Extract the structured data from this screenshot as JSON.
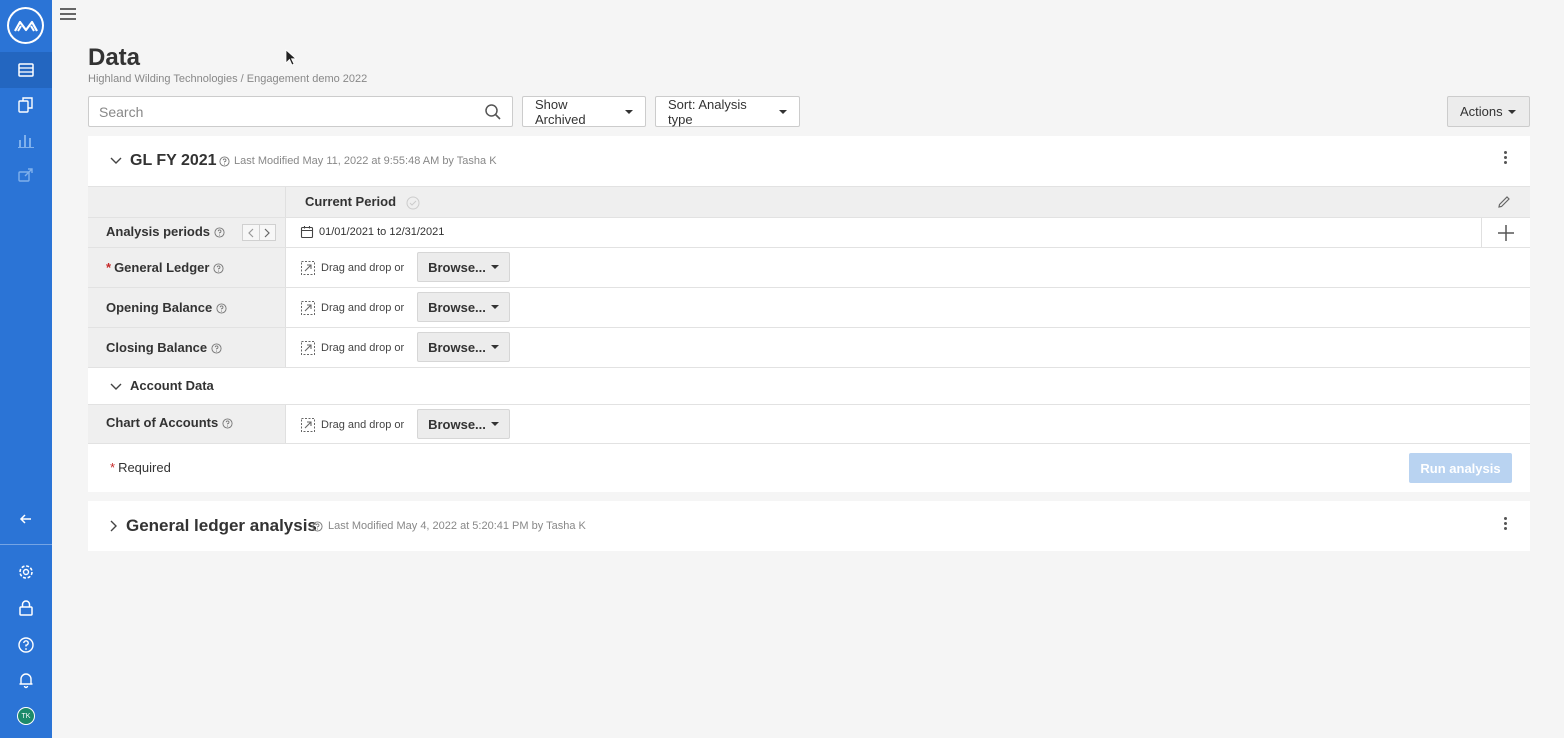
{
  "sidebar": {
    "logo": "mindbridge-logo-icon",
    "items": [
      {
        "name": "data-icon",
        "active": true
      },
      {
        "name": "files-icon",
        "active": false
      },
      {
        "name": "chart-icon",
        "active": false
      },
      {
        "name": "export-icon",
        "active": false
      }
    ],
    "bottom_items": [
      "back-arrow-icon",
      "gear-icon",
      "lock-icon",
      "help-icon",
      "bell-icon"
    ],
    "avatar_initials": "TK"
  },
  "header": {
    "title": "Data",
    "breadcrumb": "Highland Wilding Technologies / Engagement demo 2022"
  },
  "toolbar": {
    "search_placeholder": "Search",
    "show_archived_label": "Show Archived",
    "sort_label": "Sort: Analysis type",
    "actions_label": "Actions"
  },
  "analyses": [
    {
      "title": "GL FY 2021",
      "meta": "Last Modified May 11, 2022 at 9:55:48 AM by Tasha K",
      "period_header": "Current Period",
      "rows": {
        "analysis_periods_label": "Analysis periods",
        "date_range": "01/01/2021 to 12/31/2021",
        "general_ledger_label": "General Ledger",
        "opening_balance_label": "Opening Balance",
        "closing_balance_label": "Closing Balance",
        "account_data_title": "Account Data",
        "chart_of_accounts_label": "Chart of Accounts"
      },
      "drop_text": "Drag and drop or",
      "browse_label": "Browse...",
      "required_note": "Required",
      "required_star": "*",
      "run_label": "Run analysis"
    },
    {
      "title": "General ledger analysis",
      "meta": "Last Modified May 4, 2022 at 5:20:41 PM by Tasha K"
    }
  ],
  "colors": {
    "sidebar": "#2b74d6",
    "required": "#c62828",
    "run_disabled": "#b9d3f1"
  }
}
